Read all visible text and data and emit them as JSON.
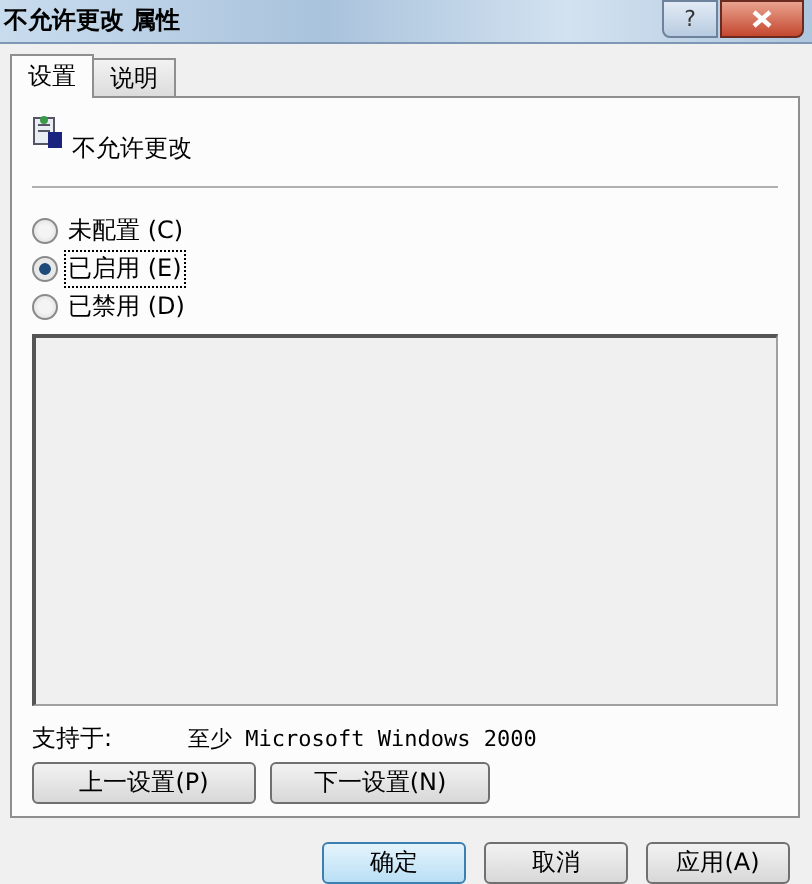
{
  "window": {
    "title": "不允许更改 属性",
    "help": "?"
  },
  "tabs": [
    {
      "label": "设置",
      "selected": true
    },
    {
      "label": "说明",
      "selected": false
    }
  ],
  "setting_name": "不允许更改",
  "options": [
    {
      "label": "未配置 (C)",
      "selected": false
    },
    {
      "label": "已启用 (E)",
      "selected": true
    },
    {
      "label": "已禁用 (D)",
      "selected": false
    }
  ],
  "supported_label": "支持于:",
  "supported_value": "至少 Microsoft Windows 2000",
  "nav_buttons": [
    "上一设置(P)",
    "下一设置(N)"
  ],
  "buttons": [
    {
      "label": "确定",
      "default": true
    },
    {
      "label": "取消",
      "default": false
    },
    {
      "label": "应用(A)",
      "default": false
    }
  ]
}
